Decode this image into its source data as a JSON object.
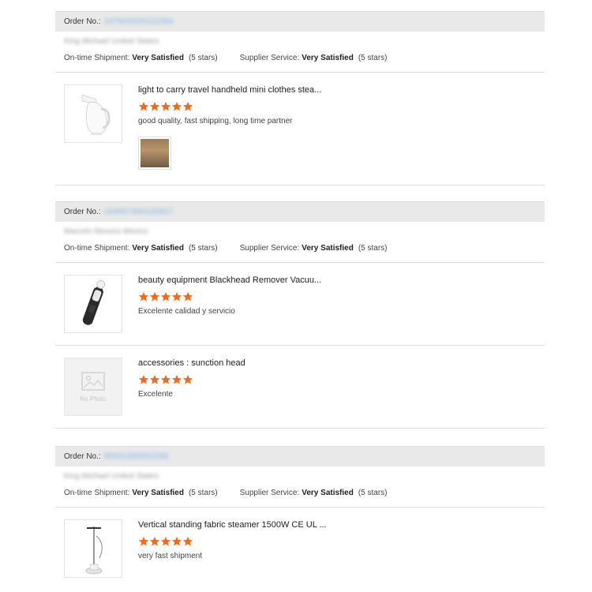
{
  "labels": {
    "order_no": "Order No.:",
    "ontime": "On-time Shipment:",
    "supplier": "Supplier Service:"
  },
  "star_color": "#f26a1b",
  "orders": [
    {
      "order_no": "147943316122284",
      "buyer": "King Michael United States",
      "ontime_value": "Very Satisfied",
      "ontime_stars": "(5 stars)",
      "supplier_value": "Very Satisfied",
      "supplier_stars": "(5 stars)",
      "items": [
        {
          "title": "light to carry travel handheld mini clothes stea...",
          "rating": 5,
          "comment": "good quality, fast shipping, long time partner",
          "thumb_icon": "handheld-steamer-image",
          "has_review_photo": true
        }
      ]
    },
    {
      "order_no": "164657460132817",
      "buyer": "Marcelo Moreno Mexico",
      "ontime_value": "Very Satisfied",
      "ontime_stars": "(5 stars)",
      "supplier_value": "Very Satisfied",
      "supplier_stars": "(5 stars)",
      "items": [
        {
          "title": "beauty equipment Blackhead Remover Vacuu...",
          "rating": 5,
          "comment": "Excelente calidad y servicio",
          "thumb_icon": "blackhead-remover-image"
        },
        {
          "title": "accessories : sunction head",
          "rating": 5,
          "comment": "Excelente",
          "thumb_icon": "no-photo-placeholder",
          "no_photo_text": "No Photo"
        }
      ]
    },
    {
      "order_no": "90631555552286",
      "buyer": "King Michael United States",
      "ontime_value": "Very Satisfied",
      "ontime_stars": "(5 stars)",
      "supplier_value": "Very Satisfied",
      "supplier_stars": "(5 stars)",
      "items": [
        {
          "title": "Vertical standing fabric steamer 1500W CE UL ...",
          "rating": 5,
          "comment": "very fast shipment",
          "thumb_icon": "standing-steamer-image"
        }
      ]
    }
  ]
}
